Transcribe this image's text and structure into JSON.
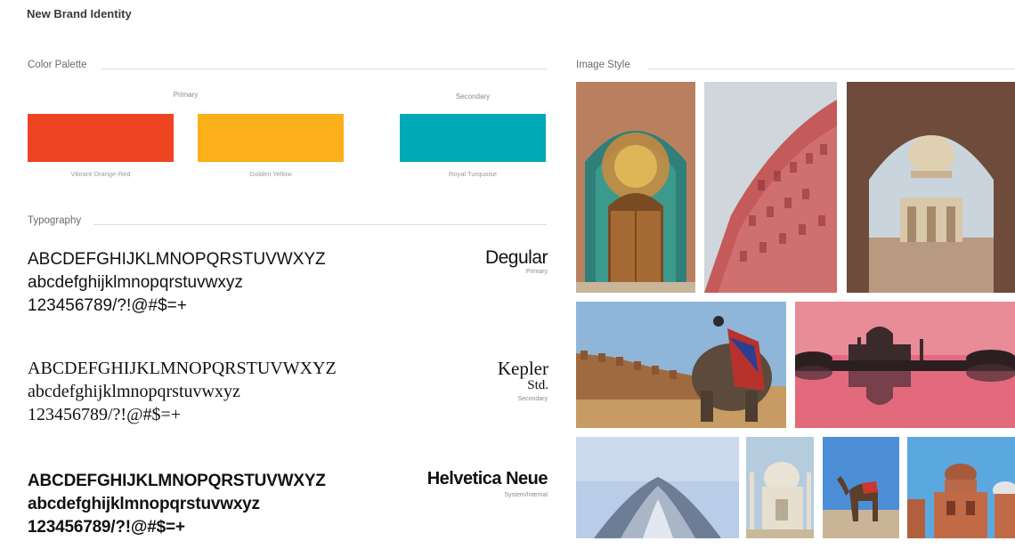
{
  "page": {
    "title": "New Brand Identity"
  },
  "color_palette": {
    "label": "Color Palette",
    "primary_label": "Primary",
    "secondary_label": "Secondary",
    "colors": [
      {
        "name": "Vibrant Orange-Red",
        "hex": "#EE4422"
      },
      {
        "name": "Golden Yellow",
        "hex": "#FBB01A"
      },
      {
        "name": "Royal Turquoise",
        "hex": "#01A8B5"
      }
    ]
  },
  "typography": {
    "label": "Typography",
    "fonts": [
      {
        "name": "Degular",
        "role": "Primary",
        "uppercase": "ABCDEFGHIJKLMNOPQRSTUVWXYZ",
        "lowercase": "abcdefghijklmnopqrstuvwxyz",
        "numerals": "123456789/?!@#$=+"
      },
      {
        "name": "Kepler",
        "name_line2": "Std.",
        "role": "Secondary",
        "uppercase": "ABCDEFGHIJKLMNOPQRSTUVWXYZ",
        "lowercase": "abcdefghijklmnopqrstuvwxyz",
        "numerals": "123456789/?!@#$=+"
      },
      {
        "name": "Helvetica Neue",
        "role": "System/Internal",
        "uppercase": "ABCDEFGHIJKLMNOPQRSTUVWXYZ",
        "lowercase": "abcdefghijklmnopqrstuvwxyz",
        "numerals": "123456789/?!@#$=+"
      }
    ]
  },
  "image_style": {
    "label": "Image Style",
    "photos": [
      "peacock-gate-photo",
      "hawa-mahal-photo",
      "arch-pavilion-photo",
      "elephant-fort-photo",
      "palace-reflection-photo",
      "lotus-temple-photo",
      "taj-mahal-photo",
      "camel-desert-photo",
      "red-fort-photo"
    ]
  }
}
